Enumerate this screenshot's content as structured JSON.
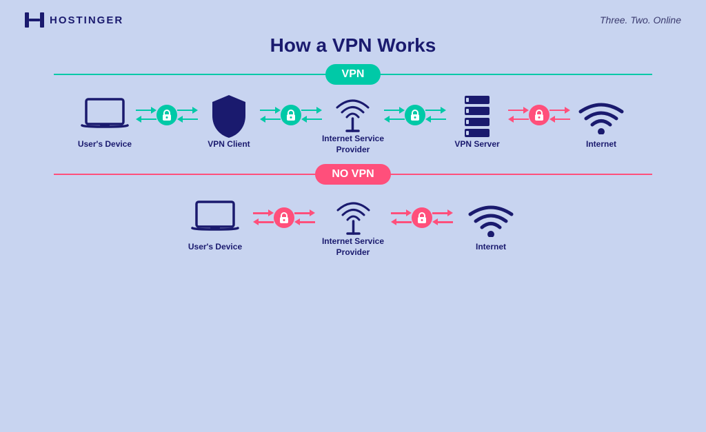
{
  "header": {
    "logo_text": "HOSTINGER",
    "tagline": "Three. Two. Online"
  },
  "main_title": "How a VPN Works",
  "vpn_section": {
    "badge": "VPN",
    "items": [
      {
        "id": "user-device-vpn",
        "label": "User's Device"
      },
      {
        "id": "vpn-client",
        "label": "VPN Client"
      },
      {
        "id": "isp-vpn",
        "label": "Internet Service\nProvider"
      },
      {
        "id": "vpn-server",
        "label": "VPN Server"
      },
      {
        "id": "internet-vpn",
        "label": "Internet"
      }
    ],
    "connectors": [
      {
        "color": "teal"
      },
      {
        "color": "teal"
      },
      {
        "color": "teal"
      },
      {
        "color": "red"
      }
    ]
  },
  "novpn_section": {
    "badge": "NO VPN",
    "items": [
      {
        "id": "user-device-novpn",
        "label": "User's Device"
      },
      {
        "id": "isp-novpn",
        "label": "Internet Service\nProvider"
      },
      {
        "id": "internet-novpn",
        "label": "Internet"
      }
    ],
    "connectors": [
      {
        "color": "red"
      },
      {
        "color": "red"
      }
    ]
  }
}
